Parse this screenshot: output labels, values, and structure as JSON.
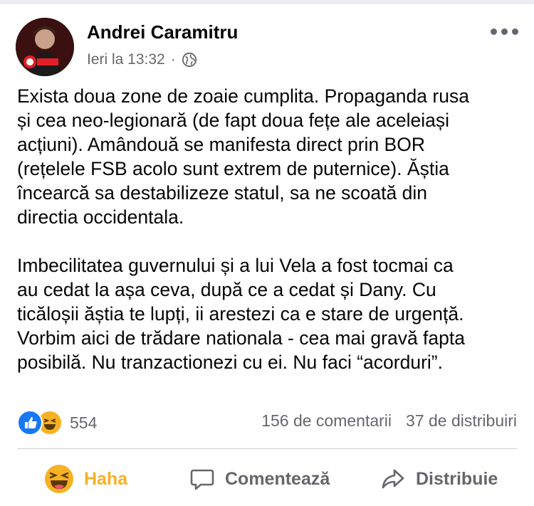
{
  "post": {
    "author": "Andrei Caramitru",
    "timestamp": "Ieri la 13:32",
    "separator": "·",
    "privacy_icon": "globe-icon",
    "avatar_badge": "STOP COVID-19",
    "paragraphs": [
      "Exista doua zone de zoaie cumplita. Propaganda rusa\nși cea neo-legionară (de fapt doua fețe ale aceleiași\nacțiuni). Amândouă se manifesta direct prin BOR\n(rețelele FSB acolo sunt extrem de puternice). Ăștia\nîncearcă sa destabilizeze statul, sa ne scoată din\ndirectia occidentala.",
      "Imbecilitatea guvernului și a lui Vela a fost tocmai ca\nau cedat la așa ceva, după ce a cedat și Dany. Cu\nticăloșii ăștia te lupți, ii arestezi ca e stare de urgență.\nVorbim aici de trădare nationala - cea mai gravă fapta\nposibilă. Nu tranzactionezi cu ei. Nu faci “acorduri”."
    ]
  },
  "engagement": {
    "reaction_count": "554",
    "reaction_icons": [
      "like-icon",
      "haha-icon"
    ],
    "comments": "156 de comentarii",
    "shares": "37 de distribuiri"
  },
  "actions": {
    "haha_label": "Haha",
    "comment_label": "Comentează",
    "share_label": "Distribuie"
  },
  "colors": {
    "accent_haha": "#f7b125",
    "like_blue": "#1877f2",
    "secondary_text": "#65676b"
  }
}
